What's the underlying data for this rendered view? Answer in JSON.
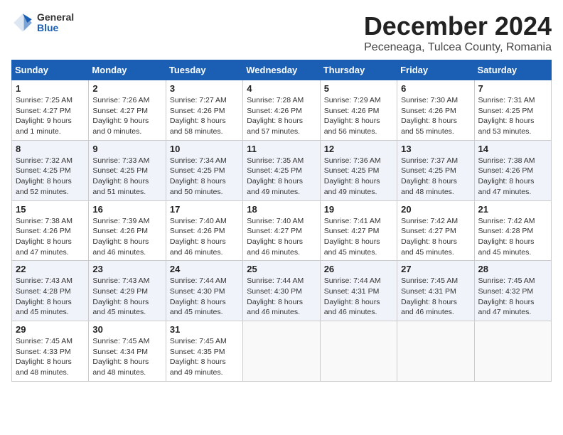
{
  "header": {
    "logo_general": "General",
    "logo_blue": "Blue",
    "month_title": "December 2024",
    "location": "Peceneaga, Tulcea County, Romania"
  },
  "weekdays": [
    "Sunday",
    "Monday",
    "Tuesday",
    "Wednesday",
    "Thursday",
    "Friday",
    "Saturday"
  ],
  "weeks": [
    [
      {
        "day": "1",
        "sunrise": "7:25 AM",
        "sunset": "4:27 PM",
        "daylight": "9 hours and 1 minute."
      },
      {
        "day": "2",
        "sunrise": "7:26 AM",
        "sunset": "4:27 PM",
        "daylight": "9 hours and 0 minutes."
      },
      {
        "day": "3",
        "sunrise": "7:27 AM",
        "sunset": "4:26 PM",
        "daylight": "8 hours and 58 minutes."
      },
      {
        "day": "4",
        "sunrise": "7:28 AM",
        "sunset": "4:26 PM",
        "daylight": "8 hours and 57 minutes."
      },
      {
        "day": "5",
        "sunrise": "7:29 AM",
        "sunset": "4:26 PM",
        "daylight": "8 hours and 56 minutes."
      },
      {
        "day": "6",
        "sunrise": "7:30 AM",
        "sunset": "4:26 PM",
        "daylight": "8 hours and 55 minutes."
      },
      {
        "day": "7",
        "sunrise": "7:31 AM",
        "sunset": "4:25 PM",
        "daylight": "8 hours and 53 minutes."
      }
    ],
    [
      {
        "day": "8",
        "sunrise": "7:32 AM",
        "sunset": "4:25 PM",
        "daylight": "8 hours and 52 minutes."
      },
      {
        "day": "9",
        "sunrise": "7:33 AM",
        "sunset": "4:25 PM",
        "daylight": "8 hours and 51 minutes."
      },
      {
        "day": "10",
        "sunrise": "7:34 AM",
        "sunset": "4:25 PM",
        "daylight": "8 hours and 50 minutes."
      },
      {
        "day": "11",
        "sunrise": "7:35 AM",
        "sunset": "4:25 PM",
        "daylight": "8 hours and 49 minutes."
      },
      {
        "day": "12",
        "sunrise": "7:36 AM",
        "sunset": "4:25 PM",
        "daylight": "8 hours and 49 minutes."
      },
      {
        "day": "13",
        "sunrise": "7:37 AM",
        "sunset": "4:25 PM",
        "daylight": "8 hours and 48 minutes."
      },
      {
        "day": "14",
        "sunrise": "7:38 AM",
        "sunset": "4:26 PM",
        "daylight": "8 hours and 47 minutes."
      }
    ],
    [
      {
        "day": "15",
        "sunrise": "7:38 AM",
        "sunset": "4:26 PM",
        "daylight": "8 hours and 47 minutes."
      },
      {
        "day": "16",
        "sunrise": "7:39 AM",
        "sunset": "4:26 PM",
        "daylight": "8 hours and 46 minutes."
      },
      {
        "day": "17",
        "sunrise": "7:40 AM",
        "sunset": "4:26 PM",
        "daylight": "8 hours and 46 minutes."
      },
      {
        "day": "18",
        "sunrise": "7:40 AM",
        "sunset": "4:27 PM",
        "daylight": "8 hours and 46 minutes."
      },
      {
        "day": "19",
        "sunrise": "7:41 AM",
        "sunset": "4:27 PM",
        "daylight": "8 hours and 45 minutes."
      },
      {
        "day": "20",
        "sunrise": "7:42 AM",
        "sunset": "4:27 PM",
        "daylight": "8 hours and 45 minutes."
      },
      {
        "day": "21",
        "sunrise": "7:42 AM",
        "sunset": "4:28 PM",
        "daylight": "8 hours and 45 minutes."
      }
    ],
    [
      {
        "day": "22",
        "sunrise": "7:43 AM",
        "sunset": "4:28 PM",
        "daylight": "8 hours and 45 minutes."
      },
      {
        "day": "23",
        "sunrise": "7:43 AM",
        "sunset": "4:29 PM",
        "daylight": "8 hours and 45 minutes."
      },
      {
        "day": "24",
        "sunrise": "7:44 AM",
        "sunset": "4:30 PM",
        "daylight": "8 hours and 45 minutes."
      },
      {
        "day": "25",
        "sunrise": "7:44 AM",
        "sunset": "4:30 PM",
        "daylight": "8 hours and 46 minutes."
      },
      {
        "day": "26",
        "sunrise": "7:44 AM",
        "sunset": "4:31 PM",
        "daylight": "8 hours and 46 minutes."
      },
      {
        "day": "27",
        "sunrise": "7:45 AM",
        "sunset": "4:31 PM",
        "daylight": "8 hours and 46 minutes."
      },
      {
        "day": "28",
        "sunrise": "7:45 AM",
        "sunset": "4:32 PM",
        "daylight": "8 hours and 47 minutes."
      }
    ],
    [
      {
        "day": "29",
        "sunrise": "7:45 AM",
        "sunset": "4:33 PM",
        "daylight": "8 hours and 48 minutes."
      },
      {
        "day": "30",
        "sunrise": "7:45 AM",
        "sunset": "4:34 PM",
        "daylight": "8 hours and 48 minutes."
      },
      {
        "day": "31",
        "sunrise": "7:45 AM",
        "sunset": "4:35 PM",
        "daylight": "8 hours and 49 minutes."
      },
      null,
      null,
      null,
      null
    ]
  ]
}
